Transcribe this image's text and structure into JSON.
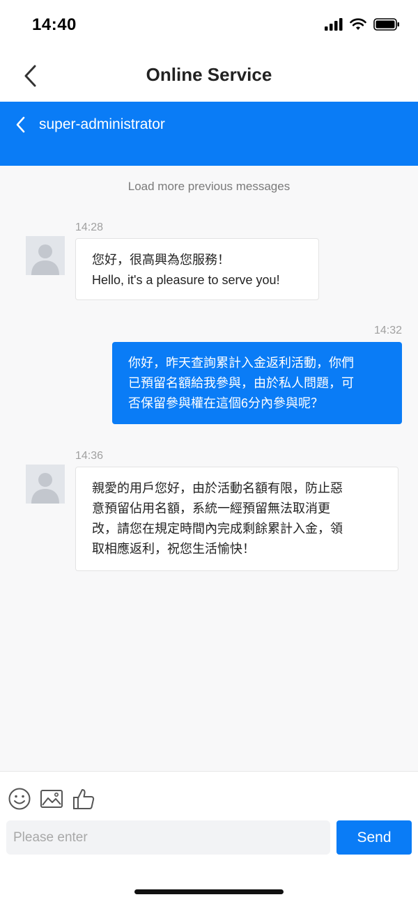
{
  "status_bar": {
    "time": "14:40"
  },
  "nav": {
    "title": "Online Service"
  },
  "chat_header": {
    "title": "super-administrator"
  },
  "chat": {
    "load_more": "Load more previous messages",
    "messages": [
      {
        "time": "14:28",
        "direction": "in",
        "lines": [
          "您好，很高興為您服務！",
          "Hello, it's a pleasure to serve you!"
        ]
      },
      {
        "time": "14:32",
        "direction": "out",
        "lines": [
          "你好，昨天查詢累計入金返利活動，你們",
          "已預留名額給我參與，由於私人問題，可",
          "否保留參與權在這個6分內參與呢？"
        ]
      },
      {
        "time": "14:36",
        "direction": "in",
        "lines": [
          "親愛的用戶您好，由於活動名額有限，防止惡",
          "意預留佔用名額，系統一經預留無法取消更",
          "改，請您在規定時間內完成剩餘累計入金，領",
          "取相應返利，祝您生活愉快！"
        ]
      }
    ]
  },
  "input": {
    "placeholder": "Please enter",
    "value": ""
  },
  "send_label": "Send",
  "icons": [
    "signal-icon",
    "wifi-icon",
    "battery-icon",
    "back-chevron-icon",
    "emoji-icon",
    "image-icon",
    "thumbs-up-icon",
    "avatar-icon"
  ],
  "colors": {
    "accent": "#0a7cf6",
    "chat_bg": "#f8f8f9",
    "timestamp": "#a0a0a0"
  }
}
